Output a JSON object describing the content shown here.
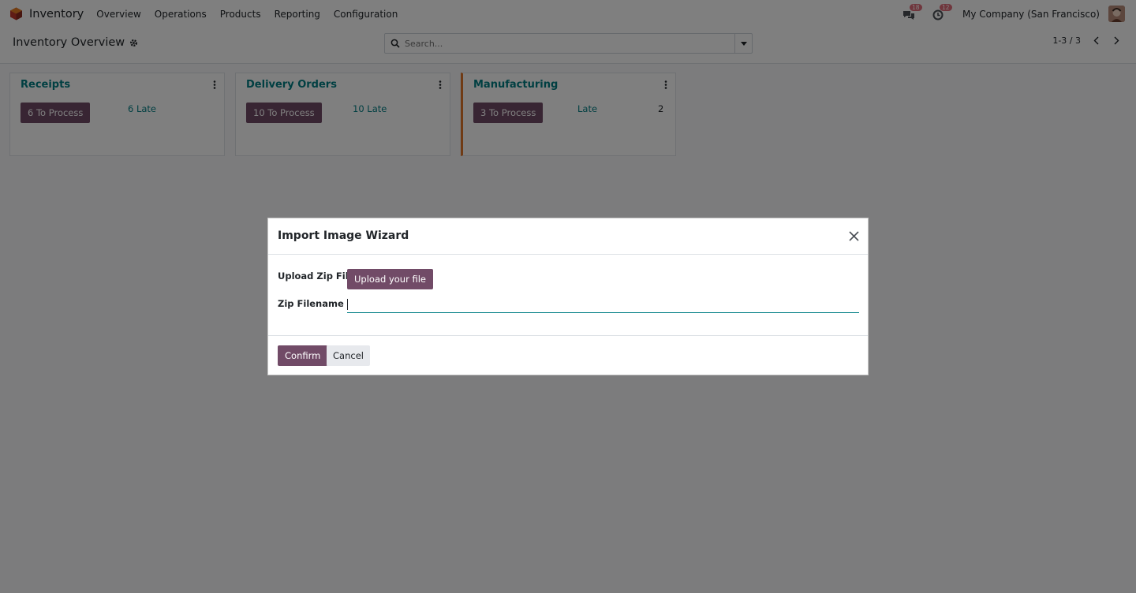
{
  "navbar": {
    "app_name": "Inventory",
    "menu": [
      "Overview",
      "Operations",
      "Products",
      "Reporting",
      "Configuration"
    ],
    "messages_badge": "18",
    "activities_badge": "12",
    "company": "My Company (San Francisco)",
    "icons": [
      "inventory-app-icon",
      "chat-icon",
      "clock-icon",
      "user-avatar"
    ]
  },
  "control_panel": {
    "breadcrumb": "Inventory Overview",
    "search_placeholder": "Search...",
    "pager": "1-3 / 3"
  },
  "kanban": {
    "cards": [
      {
        "title": "Receipts",
        "process_label": "6 To Process",
        "late_label": "6 Late",
        "count": ""
      },
      {
        "title": "Delivery Orders",
        "process_label": "10 To Process",
        "late_label": "10 Late",
        "count": ""
      },
      {
        "title": "Manufacturing",
        "process_label": "3 To Process",
        "late_label": "Late",
        "count": "2"
      }
    ]
  },
  "dialog": {
    "title": "Import Image Wizard",
    "upload_label": "Upload Zip File",
    "upload_button": "Upload your file",
    "filename_label": "Zip Filename",
    "filename_value": "",
    "confirm": "Confirm",
    "cancel": "Cancel"
  },
  "colors": {
    "primary": "#714b67",
    "link": "#017e84",
    "accent_border": "#e0762b",
    "badge": "#e06d7a"
  }
}
